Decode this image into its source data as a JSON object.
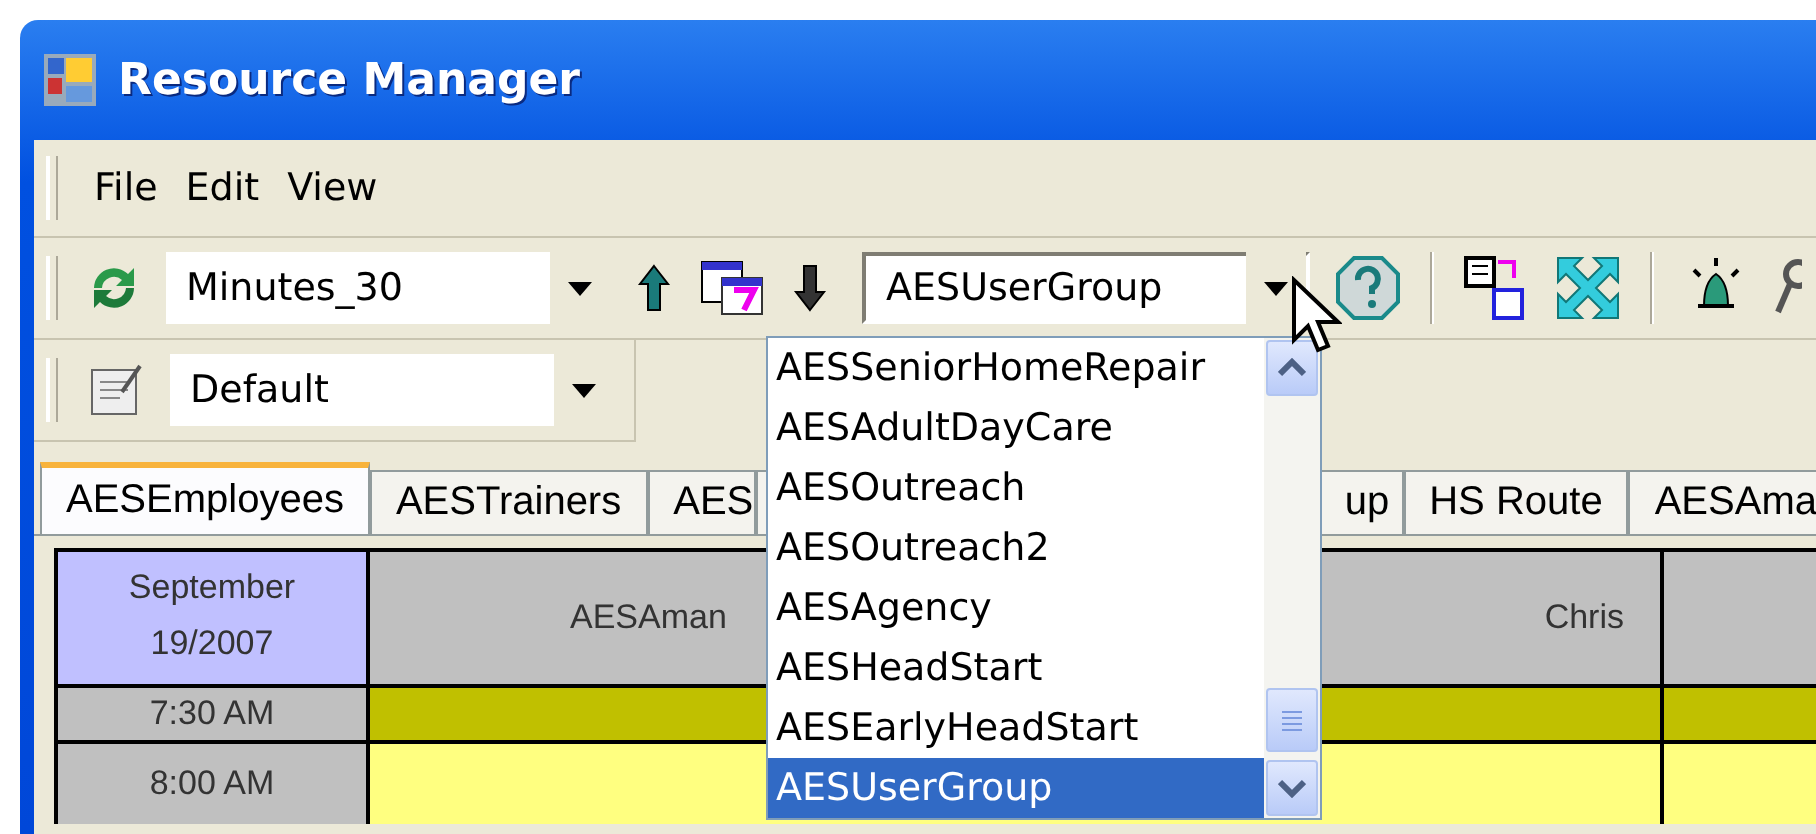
{
  "window": {
    "title": "Resource Manager"
  },
  "menu": [
    {
      "label": "File"
    },
    {
      "label": "Edit"
    },
    {
      "label": "View"
    }
  ],
  "toolbar": {
    "interval": {
      "value": "Minutes_30"
    },
    "group": {
      "value": "AESUserGroup",
      "expanded": true
    },
    "view": {
      "value": "Default"
    }
  },
  "group_list": {
    "items": [
      {
        "label": "AESSeniorHomeRepair",
        "selected": false
      },
      {
        "label": "AESAdultDayCare",
        "selected": false
      },
      {
        "label": "AESOutreach",
        "selected": false
      },
      {
        "label": "AESOutreach2",
        "selected": false
      },
      {
        "label": "AESAgency",
        "selected": false
      },
      {
        "label": "AESHeadStart",
        "selected": false
      },
      {
        "label": "AESEarlyHeadStart",
        "selected": false
      },
      {
        "label": "AESUserGroup",
        "selected": true
      }
    ]
  },
  "tabs": [
    {
      "label": "AESEmployees",
      "selected": true
    },
    {
      "label": "AESTrainers",
      "selected": false
    },
    {
      "label": "AES",
      "selected": false
    },
    {
      "label": "up",
      "selected": false
    },
    {
      "label": "HS Route",
      "selected": false
    },
    {
      "label": "AESAma",
      "selected": false
    }
  ],
  "schedule": {
    "date_line_1": "September",
    "date_line_2": "19/2007",
    "column_1": {
      "label_start": "AESAman",
      "label_end": "Chris"
    },
    "rows": [
      {
        "time": "7:30 AM",
        "color": "#c0c000"
      },
      {
        "time": "8:00 AM",
        "color": "#ffff80"
      }
    ]
  }
}
